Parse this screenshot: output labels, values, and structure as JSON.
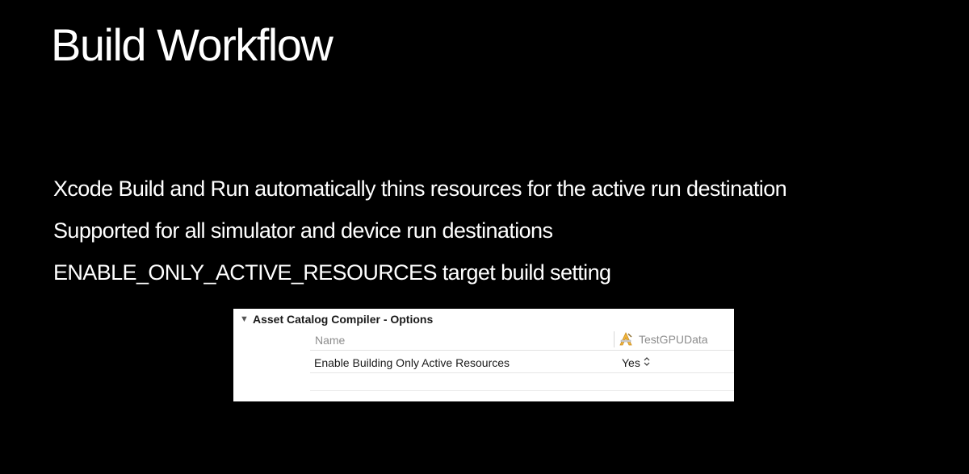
{
  "slide": {
    "title": "Build Workflow",
    "bullets": [
      "Xcode Build and Run automatically thins resources for the active run destination",
      "Supported for all simulator and device run destinations",
      "ENABLE_ONLY_ACTIVE_RESOURCES target build setting"
    ]
  },
  "build_settings": {
    "section_title": "Asset Catalog Compiler - Options",
    "disclosure_icon": "disclosure-triangle-down-icon",
    "columns": {
      "name_header": "Name",
      "target_header": "TestGPUData",
      "target_icon": "app-target-icon"
    },
    "rows": [
      {
        "name": "Enable Building Only Active Resources",
        "value": "Yes",
        "value_icon": "up-down-chevron-icon"
      }
    ]
  }
}
